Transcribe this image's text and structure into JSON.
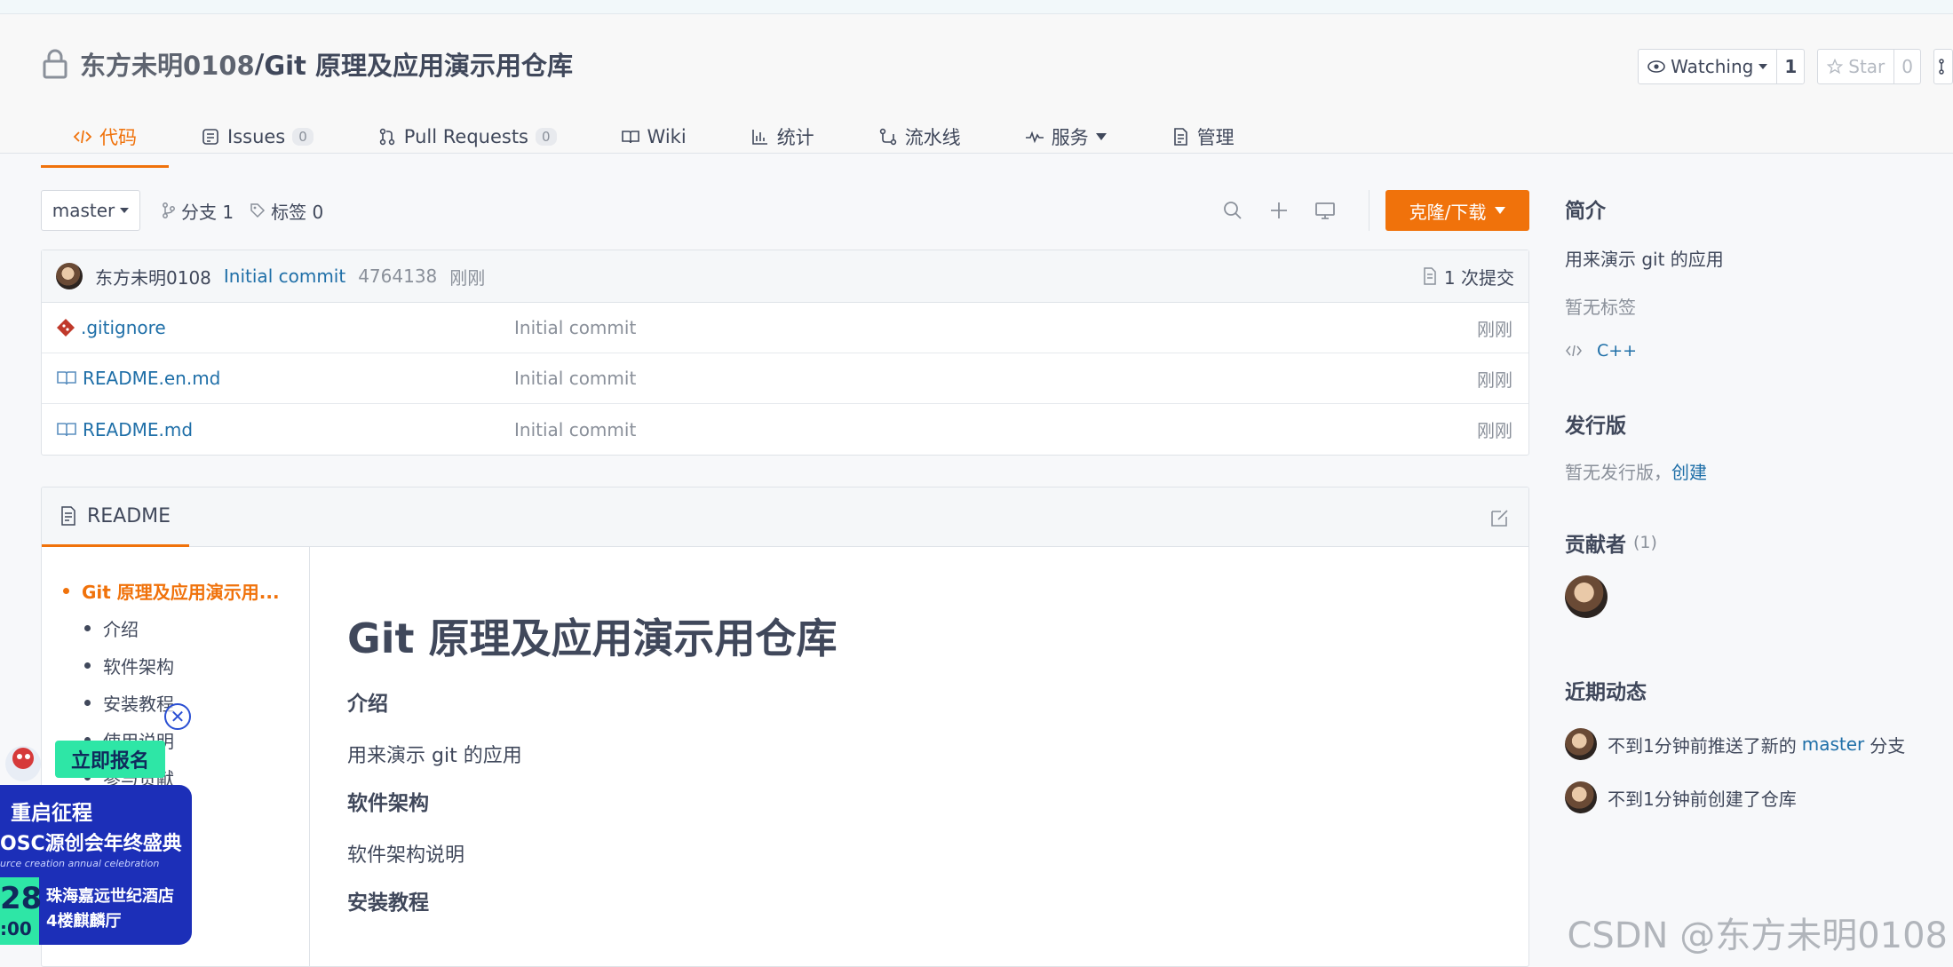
{
  "repo": {
    "owner": "东方未明0108",
    "separator": "/",
    "name": "Git 原理及应用演示用仓库"
  },
  "actions": {
    "watch_label": "Watching",
    "watch_count": "1",
    "star_label": "Star",
    "star_count": "0"
  },
  "tabs": [
    {
      "label": "代码",
      "badge": ""
    },
    {
      "label": "Issues",
      "badge": "0"
    },
    {
      "label": "Pull Requests",
      "badge": "0"
    },
    {
      "label": "Wiki",
      "badge": ""
    },
    {
      "label": "统计",
      "badge": ""
    },
    {
      "label": "流水线",
      "badge": ""
    },
    {
      "label": "服务",
      "badge": ""
    },
    {
      "label": "管理",
      "badge": ""
    }
  ],
  "toolbar": {
    "branch": "master",
    "branches": "分支 1",
    "tags": "标签 0",
    "clone_label": "克隆/下载"
  },
  "commit": {
    "author": "东方未明0108",
    "message": "Initial commit",
    "hash": "4764138",
    "time": "刚刚",
    "count": "1 次提交"
  },
  "files": [
    {
      "name": ".gitignore",
      "message": "Initial commit",
      "time": "刚刚"
    },
    {
      "name": "README.en.md",
      "message": "Initial commit",
      "time": "刚刚"
    },
    {
      "name": "README.md",
      "message": "Initial commit",
      "time": "刚刚"
    }
  ],
  "readme": {
    "tab_label": "README",
    "toc": [
      "Git 原理及应用演示用...",
      "介绍",
      "软件架构",
      "安装教程",
      "使用说明",
      "参与贡献"
    ],
    "h1": "Git 原理及应用演示用仓库",
    "sections": [
      {
        "heading": "介绍",
        "text": "用来演示 git 的应用"
      },
      {
        "heading": "软件架构",
        "text": "软件架构说明"
      },
      {
        "heading": "安装教程",
        "text": ""
      }
    ]
  },
  "sidebar": {
    "intro_title": "简介",
    "intro_text": "用来演示 git 的应用",
    "no_tags": "暂无标签",
    "language": "C++",
    "release_title": "发行版",
    "release_text": "暂无发行版，",
    "release_link": "创建",
    "contributors_title": "贡献者",
    "contributors_count": "(1)",
    "activity_title": "近期动态",
    "activity": [
      {
        "text": "不到1分钟前推送了新的",
        "link": "master",
        "suffix": "分支"
      },
      {
        "text": "不到1分钟前创建了仓库",
        "link": "",
        "suffix": ""
      }
    ]
  },
  "ad": {
    "signup": "立即报名",
    "line1": "重启征程",
    "line2": "OSC源创会年终盛典",
    "line3": "urce creation annual celebration",
    "date_day": "28",
    "date_hour": ":00",
    "venue_line1": "珠海嘉远世纪酒店",
    "venue_line2": "4楼麒麟厅"
  },
  "watermark": "CSDN @东方未明0108",
  "colors": {
    "accent": "#f0720b",
    "link": "#1f6fa8",
    "text": "#40485b",
    "muted": "#8a909a"
  }
}
